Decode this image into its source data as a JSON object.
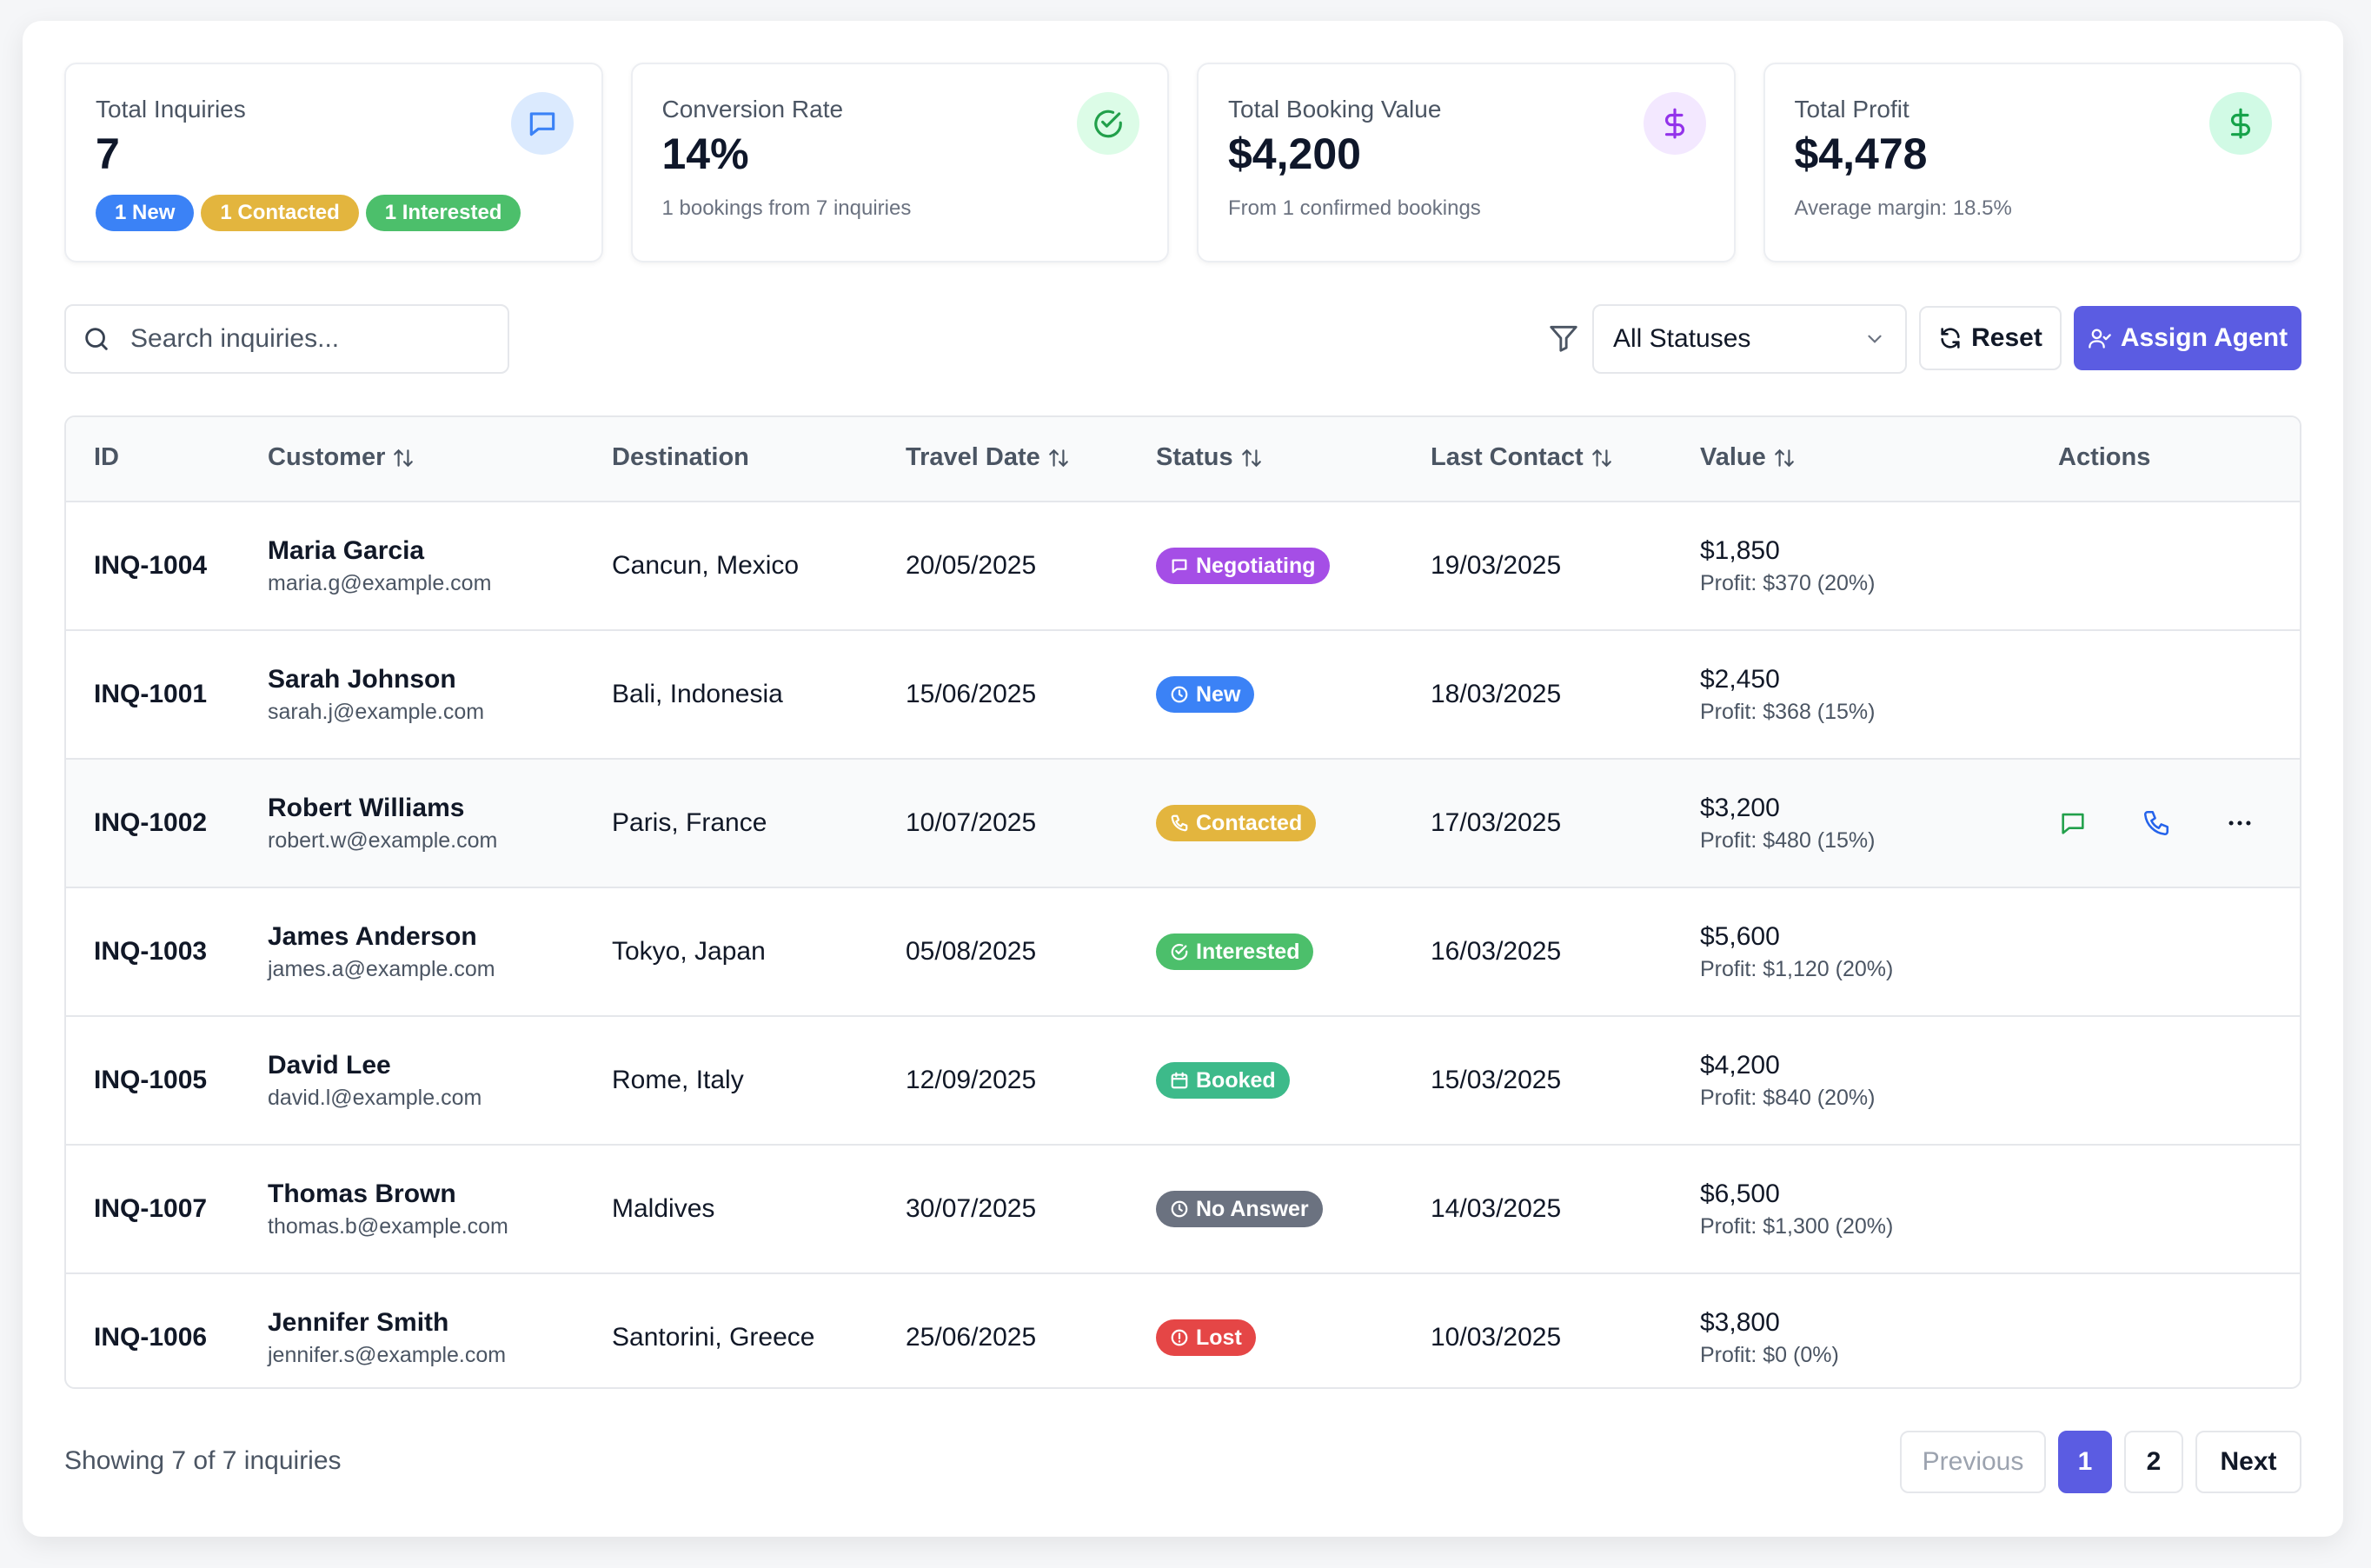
{
  "stats": {
    "inquiries": {
      "title": "Total Inquiries",
      "value": "7",
      "pills": [
        {
          "label": "1 New",
          "color": "#3b82f6"
        },
        {
          "label": "1 Contacted",
          "color": "#e3b53e"
        },
        {
          "label": "1 Interested",
          "color": "#4cbf6b"
        }
      ]
    },
    "conversion": {
      "title": "Conversion Rate",
      "value": "14%",
      "sub": "1 bookings from 7 inquiries"
    },
    "booking": {
      "title": "Total Booking Value",
      "value": "$4,200",
      "sub": "From 1 confirmed bookings"
    },
    "profit": {
      "title": "Total Profit",
      "value": "$4,478",
      "sub": "Average margin: 18.5%"
    }
  },
  "toolbar": {
    "search_placeholder": "Search inquiries...",
    "status_filter": "All Statuses",
    "reset_label": "Reset",
    "assign_label": "Assign Agent"
  },
  "table": {
    "headers": {
      "id": "ID",
      "customer": "Customer",
      "destination": "Destination",
      "travel_date": "Travel Date",
      "status": "Status",
      "last_contact": "Last Contact",
      "value": "Value",
      "actions": "Actions"
    },
    "rows": [
      {
        "id": "INQ-1004",
        "name": "Maria Garcia",
        "email": "maria.g@example.com",
        "destination": "Cancun, Mexico",
        "travel_date": "20/05/2025",
        "status": "Negotiating",
        "status_color": "#a54ee6",
        "status_icon": "message-icon",
        "last_contact": "19/03/2025",
        "value": "$1,850",
        "profit": "Profit: $370 (20%)"
      },
      {
        "id": "INQ-1001",
        "name": "Sarah Johnson",
        "email": "sarah.j@example.com",
        "destination": "Bali, Indonesia",
        "travel_date": "15/06/2025",
        "status": "New",
        "status_color": "#3b82f6",
        "status_icon": "clock-icon",
        "last_contact": "18/03/2025",
        "value": "$2,450",
        "profit": "Profit: $368 (15%)"
      },
      {
        "id": "INQ-1002",
        "name": "Robert Williams",
        "email": "robert.w@example.com",
        "destination": "Paris, France",
        "travel_date": "10/07/2025",
        "status": "Contacted",
        "status_color": "#e3b53e",
        "status_icon": "phone-icon",
        "last_contact": "17/03/2025",
        "value": "$3,200",
        "profit": "Profit: $480 (15%)"
      },
      {
        "id": "INQ-1003",
        "name": "James Anderson",
        "email": "james.a@example.com",
        "destination": "Tokyo, Japan",
        "travel_date": "05/08/2025",
        "status": "Interested",
        "status_color": "#4cbf6b",
        "status_icon": "check-circle-icon",
        "last_contact": "16/03/2025",
        "value": "$5,600",
        "profit": "Profit: $1,120 (20%)"
      },
      {
        "id": "INQ-1005",
        "name": "David Lee",
        "email": "david.l@example.com",
        "destination": "Rome, Italy",
        "travel_date": "12/09/2025",
        "status": "Booked",
        "status_color": "#3dba8a",
        "status_icon": "calendar-icon",
        "last_contact": "15/03/2025",
        "value": "$4,200",
        "profit": "Profit: $840 (20%)"
      },
      {
        "id": "INQ-1007",
        "name": "Thomas Brown",
        "email": "thomas.b@example.com",
        "destination": "Maldives",
        "travel_date": "30/07/2025",
        "status": "No Answer",
        "status_color": "#6b7280",
        "status_icon": "clock-icon",
        "last_contact": "14/03/2025",
        "value": "$6,500",
        "profit": "Profit: $1,300 (20%)"
      },
      {
        "id": "INQ-1006",
        "name": "Jennifer Smith",
        "email": "jennifer.s@example.com",
        "destination": "Santorini, Greece",
        "travel_date": "25/06/2025",
        "status": "Lost",
        "status_color": "#e54646",
        "status_icon": "alert-circle-icon",
        "last_contact": "10/03/2025",
        "value": "$3,800",
        "profit": "Profit: $0 (0%)"
      }
    ]
  },
  "footer": {
    "showing": "Showing 7 of 7 inquiries",
    "previous": "Previous",
    "pages": [
      "1",
      "2"
    ],
    "next": "Next"
  },
  "colors": {
    "accent": "#5b5ce2"
  }
}
